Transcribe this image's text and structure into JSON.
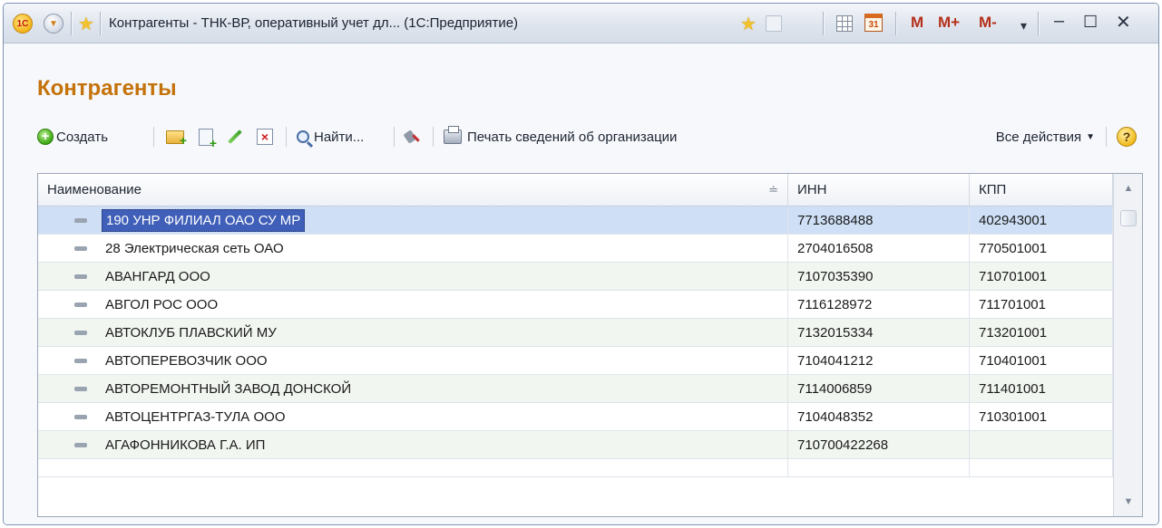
{
  "window": {
    "title": "Контрагенты - ТНК-ВР, оперативный учет дл... (1С:Предприятие)",
    "logo": "1С",
    "calendar_day": "31",
    "memory_buttons": [
      "M",
      "M+",
      "M-"
    ]
  },
  "form": {
    "title": "Контрагенты"
  },
  "toolbar": {
    "create_label": "Создать",
    "find_label": "Найти...",
    "print_label": "Печать сведений об организации",
    "all_actions_label": "Все действия",
    "help_label": "?"
  },
  "grid": {
    "columns": [
      "Наименование",
      "ИНН",
      "КПП"
    ],
    "rows": [
      {
        "name": "190 УНР ФИЛИАЛ ОАО СУ МР",
        "inn": "7713688488",
        "kpp": "402943001",
        "selected": true
      },
      {
        "name": "28 Электрическая сеть ОАО",
        "inn": "2704016508",
        "kpp": "770501001"
      },
      {
        "name": "АВАНГАРД ООО",
        "inn": "7107035390",
        "kpp": "710701001"
      },
      {
        "name": "АВГОЛ РОС ООО",
        "inn": "7116128972",
        "kpp": "711701001"
      },
      {
        "name": "АВТОКЛУБ ПЛАВСКИЙ МУ",
        "inn": "7132015334",
        "kpp": "713201001"
      },
      {
        "name": "АВТОПЕРЕВОЗЧИК ООО",
        "inn": "7104041212",
        "kpp": "710401001"
      },
      {
        "name": "АВТОРЕМОНТНЫЙ ЗАВОД ДОНСКОЙ",
        "inn": "7114006859",
        "kpp": "711401001"
      },
      {
        "name": "АВТОЦЕНТРГАЗ-ТУЛА ООО",
        "inn": "7104048352",
        "kpp": "710301001"
      },
      {
        "name": "АГАФОННИКОВА Г.А. ИП",
        "inn": "710700422268",
        "kpp": ""
      }
    ]
  },
  "colors": {
    "title_orange": "#c4720a",
    "selection_blue": "#3f5fb8",
    "alt_row": "#f1f6f0"
  }
}
